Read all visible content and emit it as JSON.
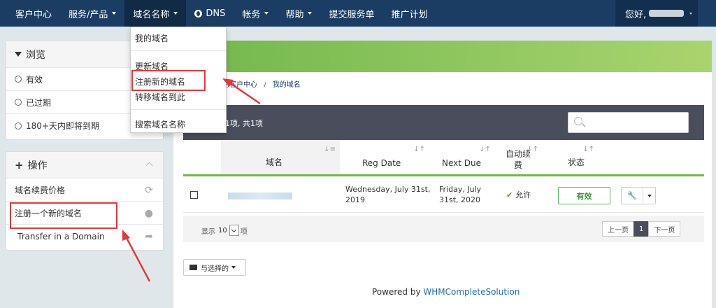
{
  "nav": {
    "items": [
      {
        "label": "客户中心",
        "caret": false
      },
      {
        "label": "服务/产品",
        "caret": true
      },
      {
        "label": "域名名称",
        "caret": true,
        "active": true
      },
      {
        "label": "DNS",
        "caret": false,
        "icon": "globe-icon"
      },
      {
        "label": "帐务",
        "caret": true
      },
      {
        "label": "帮助",
        "caret": true
      },
      {
        "label": "提交服务单",
        "caret": false
      },
      {
        "label": "推广计划",
        "caret": false
      }
    ],
    "greeting": "您好,"
  },
  "domain_menu": {
    "items": [
      "我的域名",
      "更新域名",
      "注册新的域名",
      "转移域名到此",
      "搜索域名名称"
    ]
  },
  "browse_panel": {
    "title": "浏览",
    "items": [
      "有效",
      "已过期",
      "180+天内即将到期"
    ]
  },
  "actions_panel": {
    "title": "操作",
    "items": [
      {
        "label": "域名续费价格",
        "icon": "refresh-icon"
      },
      {
        "label": "注册一个新的域名",
        "icon": "globe-icon"
      },
      {
        "label": "Transfer in a Domain",
        "icon": "share-icon"
      }
    ]
  },
  "breadcrumb": {
    "home": "的客户中心",
    "sep": "/",
    "current": "我的域名"
  },
  "table": {
    "summary": "1项, 共1项",
    "columns": [
      "域名",
      "Reg Date",
      "Next Due",
      "自动续费",
      "状态"
    ],
    "rows": [
      {
        "reg_date": "Wednesday, July 31st, 2019",
        "next_due": "Friday, July 31st, 2020",
        "auto_renew": "允许",
        "status": "有效"
      }
    ]
  },
  "pager": {
    "show_label": "显示",
    "page_size": "10",
    "items_label": "项",
    "prev": "上一页",
    "current": "1",
    "next": "下一页"
  },
  "with_selected": "与选择的",
  "footer": {
    "powered_prefix": "Powered by ",
    "powered_link": "WHMCompleteSolution"
  },
  "colors": {
    "nav_bg": "#1b3d63",
    "banner_green": "#71b74c",
    "toolbar_dark": "#4a4e5c",
    "highlight_red": "#e5373a"
  }
}
